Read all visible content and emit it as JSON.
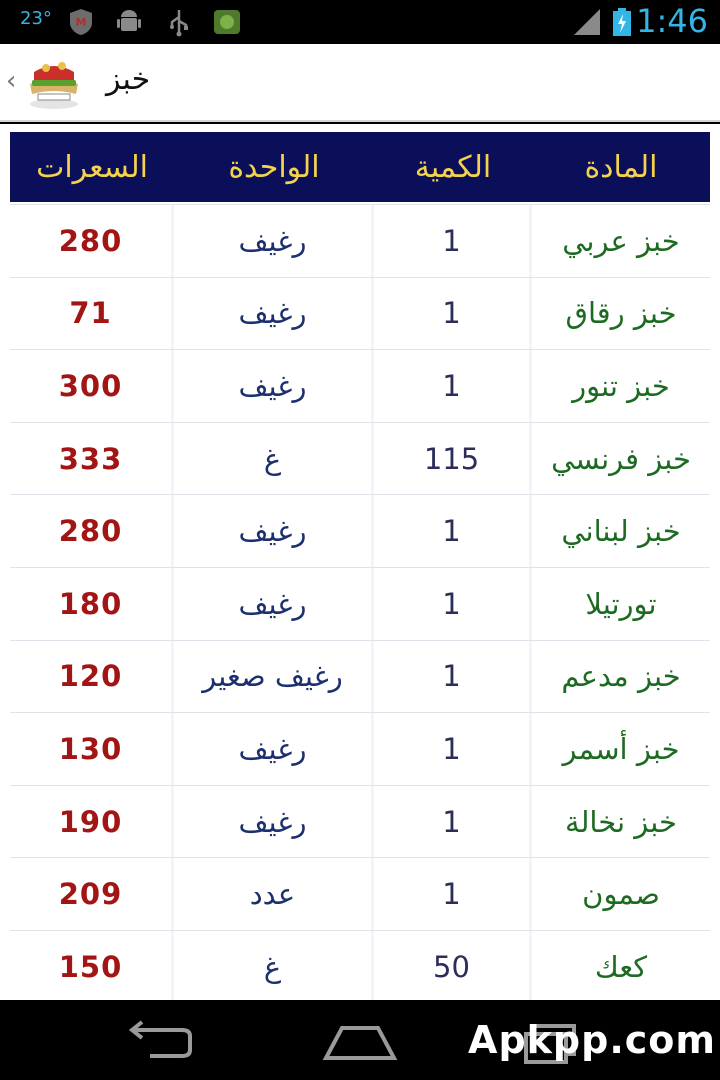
{
  "status_bar": {
    "temperature": "23°",
    "time": "1:46",
    "icons": [
      "mcafee-icon",
      "android-debug-icon",
      "usb-icon",
      "app-notification-icon",
      "signal-icon",
      "battery-icon"
    ]
  },
  "action_bar": {
    "title": "خبز",
    "logo": "sandwich-logo-icon",
    "up_icon": "chevron-left-icon"
  },
  "table": {
    "headers": {
      "item": "المادة",
      "qty": "الكمية",
      "unit": "الواحدة",
      "price": "السعرات"
    },
    "rows": [
      {
        "item": "خبز عربي",
        "qty": "1",
        "unit": "رغيف",
        "price": "280"
      },
      {
        "item": "خبز رقاق",
        "qty": "1",
        "unit": "رغيف",
        "price": "71"
      },
      {
        "item": "خبز تنور",
        "qty": "1",
        "unit": "رغيف",
        "price": "300"
      },
      {
        "item": "خبز فرنسي",
        "qty": "115",
        "unit": "غ",
        "price": "333"
      },
      {
        "item": "خبز لبناني",
        "qty": "1",
        "unit": "رغيف",
        "price": "280"
      },
      {
        "item": "تورتيلا",
        "qty": "1",
        "unit": "رغيف",
        "price": "180"
      },
      {
        "item": "خبز مدعم",
        "qty": "1",
        "unit": "رغيف صغير",
        "price": "120"
      },
      {
        "item": "خبز أسمر",
        "qty": "1",
        "unit": "رغيف",
        "price": "130"
      },
      {
        "item": "خبز نخالة",
        "qty": "1",
        "unit": "رغيف",
        "price": "190"
      },
      {
        "item": "صمون",
        "qty": "1",
        "unit": "عدد",
        "price": "209"
      },
      {
        "item": "كعك",
        "qty": "50",
        "unit": "غ",
        "price": "150"
      }
    ]
  },
  "nav_bar": {
    "buttons": [
      "back-icon",
      "home-icon",
      "recent-apps-icon"
    ],
    "watermark": "Apkpp.com"
  },
  "colors": {
    "header_bg": "#0b0f5a",
    "header_text": "#f4d24b",
    "item_text": "#1d6b22",
    "price_text": "#a31515",
    "accent": "#33b5e5"
  }
}
